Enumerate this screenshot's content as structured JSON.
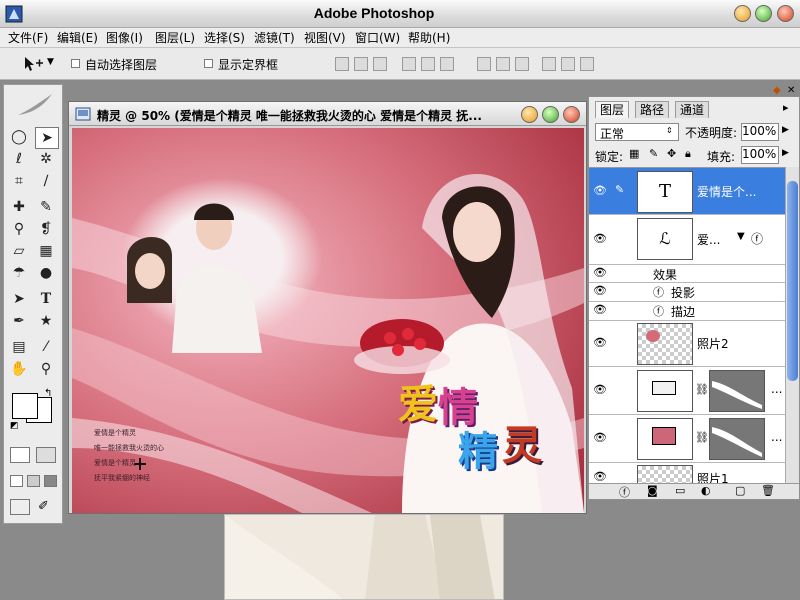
{
  "app": {
    "title": "Adobe Photoshop",
    "menu": [
      "文件(F)",
      "编辑(E)",
      "图像(I)",
      "图层(L)",
      "选择(S)",
      "滤镜(T)",
      "视图(V)",
      "窗口(W)",
      "帮助(H)"
    ]
  },
  "options": {
    "auto_select": "自动选择图层",
    "show_bounds": "显示定界框"
  },
  "document": {
    "title": "精灵 @ 50% (爱情是个精灵 唯一能拯救我火烫的心 爱情是个精灵 抚..."
  },
  "canvas": {
    "poem_lines": [
      "爱情是个精灵",
      "唯一能拯救我火烫的心",
      "爱情是个精灵",
      "抚平我紧绷的神经"
    ],
    "art_chars": [
      "爱",
      "情",
      "精",
      "灵"
    ]
  },
  "layers": {
    "tabs": [
      "图层",
      "路径",
      "通道"
    ],
    "blend_mode": "正常",
    "opacity_label": "不透明度:",
    "opacity_value": "100%",
    "lock_label": "锁定:",
    "fill_label": "填充:",
    "fill_value": "100%",
    "text_layer_name": "爱情是个...",
    "shape_layer_name": "爱...",
    "effects_label": "效果",
    "effect_shadow": "投影",
    "effect_stroke": "描边",
    "photo_layer_name": "照片2",
    "photo_layer2_name": "照片1",
    "ellipsis": "..."
  },
  "colors": {
    "accent": "#2d6fd2",
    "selected_layer": "#3a7ee0",
    "canvas_pink": "#c9606c",
    "swatch_pink": "#cc6678"
  }
}
